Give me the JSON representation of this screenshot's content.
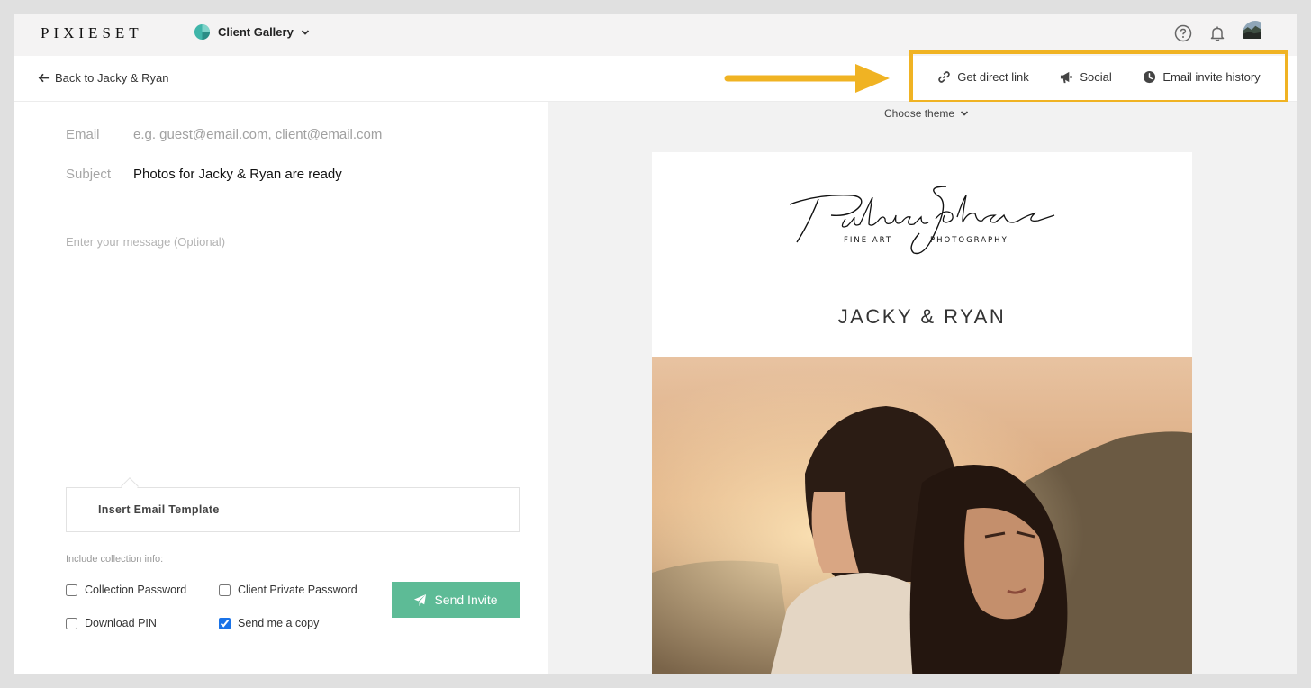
{
  "app": {
    "logo": "PIXIESET",
    "product": "Client Gallery"
  },
  "subheader": {
    "back_label": "Back to Jacky & Ryan",
    "actions": [
      {
        "label": "Get direct link",
        "icon": "link-icon"
      },
      {
        "label": "Social",
        "icon": "megaphone-icon"
      },
      {
        "label": "Email invite history",
        "icon": "clock-icon"
      }
    ]
  },
  "form": {
    "email_label": "Email",
    "email_placeholder": "e.g. guest@email.com, client@email.com",
    "email_value": "",
    "subject_label": "Subject",
    "subject_value": "Photos for Jacky & Ryan are ready",
    "message_placeholder": "Enter your message (Optional)",
    "template_label": "Insert Email Template",
    "include_label": "Include collection info:",
    "options": [
      {
        "label": "Collection Password",
        "checked": false
      },
      {
        "label": "Client Private Password",
        "checked": false
      },
      {
        "label": "Download PIN",
        "checked": false
      },
      {
        "label": "Send me a copy",
        "checked": true
      }
    ],
    "send_label": "Send Invite"
  },
  "preview": {
    "theme_label": "Choose theme",
    "brand_sub_left": "FINE ART",
    "brand_sub_right": "PHOTOGRAPHY",
    "gallery_title": "JACKY & RYAN"
  },
  "colors": {
    "accent": "#5dbb96",
    "highlight": "#f0b323"
  }
}
